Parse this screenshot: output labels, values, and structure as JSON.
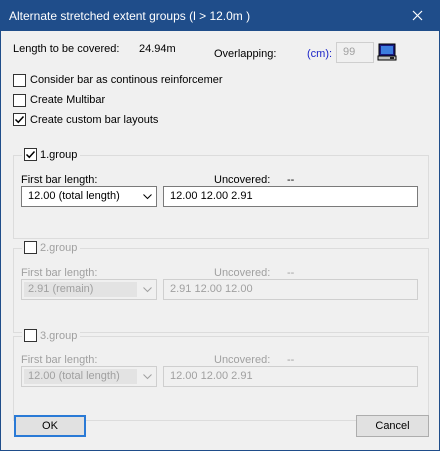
{
  "window": {
    "title": "Alternate stretched extent groups (l > 12.0m )"
  },
  "top": {
    "length_label": "Length to be covered:",
    "length_value": "24.94m",
    "overlapping_label": "Overlapping:",
    "overlapping_unit": "(cm):",
    "overlapping_value": "99"
  },
  "options": {
    "consider_bar_label": "Consider bar as continous reinforcemer",
    "consider_bar_checked": false,
    "create_multibar_label": "Create Multibar",
    "create_multibar_checked": false,
    "custom_layouts_label": "Create custom bar layouts",
    "custom_layouts_checked": true
  },
  "groups": [
    {
      "label": "1.group",
      "checked": true,
      "first_bar_label": "First bar length:",
      "first_bar_value": "12.00 (total length)",
      "uncovered_label": "Uncovered:",
      "uncovered_value": "--",
      "layout_value": "12.00 12.00 2.91"
    },
    {
      "label": "2.group",
      "checked": false,
      "first_bar_label": "First bar length:",
      "first_bar_value": "2.91 (remain)",
      "uncovered_label": "Uncovered:",
      "uncovered_value": "--",
      "layout_value": "2.91 12.00 12.00"
    },
    {
      "label": "3.group",
      "checked": false,
      "first_bar_label": "First bar length:",
      "first_bar_value": "12.00 (total length)",
      "uncovered_label": "Uncovered:",
      "uncovered_value": "--",
      "layout_value": "12.00 12.00 2.91"
    }
  ],
  "buttons": {
    "ok_label": "OK",
    "cancel_label": "Cancel"
  },
  "colors": {
    "title_bar": "#1f4d8a",
    "accent_text": "#1b24c8",
    "default_button_border": "#2a7ad6"
  }
}
